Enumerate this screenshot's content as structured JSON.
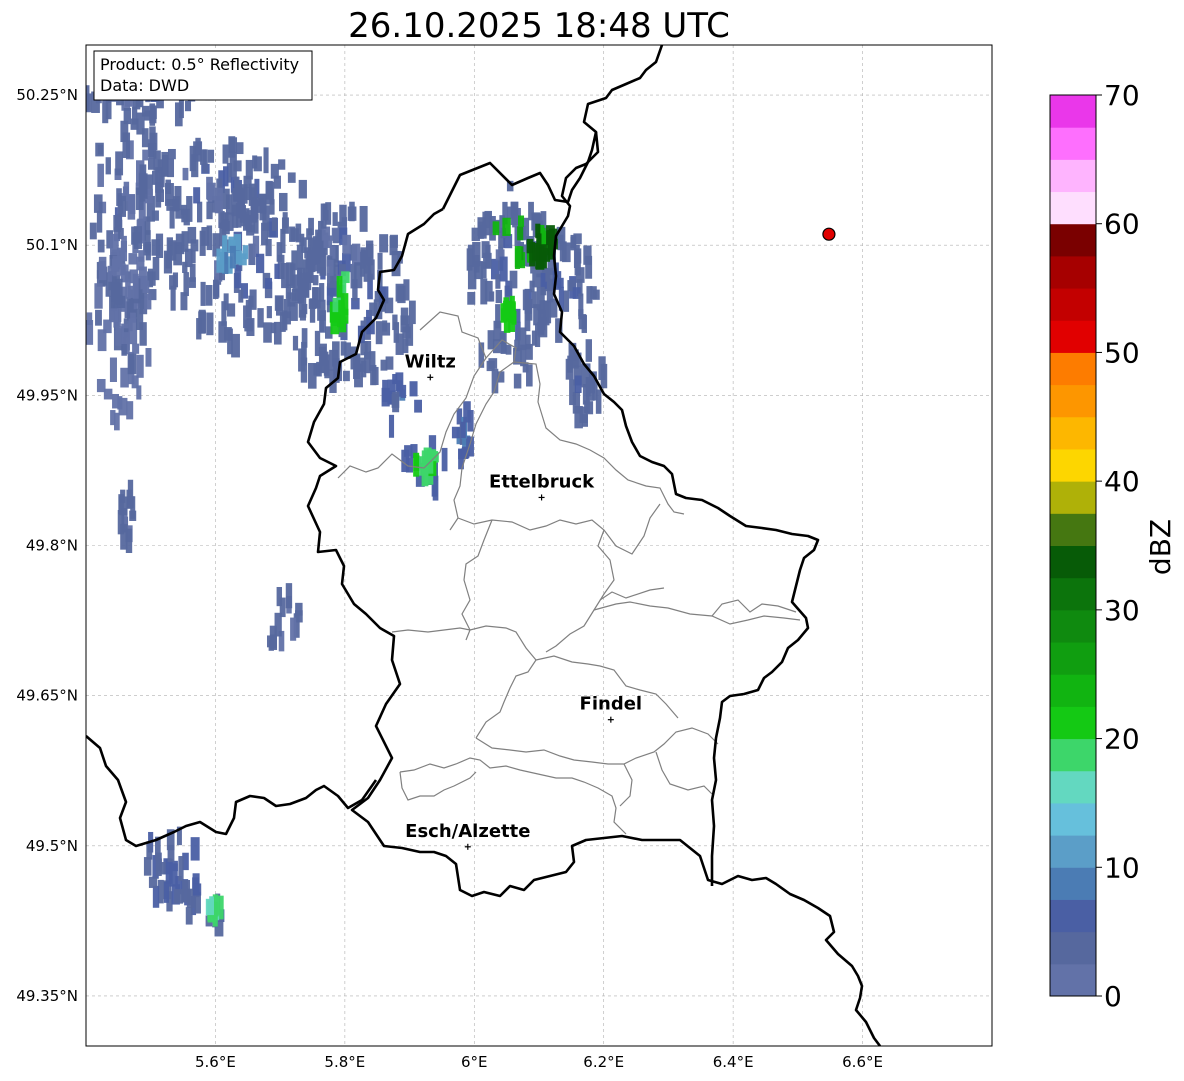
{
  "title": "26.10.2025 18:48 UTC",
  "info_box": {
    "product": "Product: 0.5° Reflectivity",
    "data": "Data: DWD"
  },
  "lon_ticks": [
    {
      "value": 5.6,
      "label": "5.6°E"
    },
    {
      "value": 5.8,
      "label": "5.8°E"
    },
    {
      "value": 6.0,
      "label": "6°E"
    },
    {
      "value": 6.2,
      "label": "6.2°E"
    },
    {
      "value": 6.4,
      "label": "6.4°E"
    },
    {
      "value": 6.6,
      "label": "6.6°E"
    }
  ],
  "lat_ticks": [
    {
      "value": 50.25,
      "label": "50.25°N"
    },
    {
      "value": 50.1,
      "label": "50.1°N"
    },
    {
      "value": 49.95,
      "label": "49.95°N"
    },
    {
      "value": 49.8,
      "label": "49.8°N"
    },
    {
      "value": 49.65,
      "label": "49.65°N"
    },
    {
      "value": 49.5,
      "label": "49.5°N"
    },
    {
      "value": 49.35,
      "label": "49.35°N"
    }
  ],
  "extent": {
    "lon_min": 5.4,
    "lon_max": 6.8,
    "lat_min": 49.3,
    "lat_max": 50.3
  },
  "cities": [
    {
      "name": "Wiltz",
      "lon": 5.932,
      "lat": 49.968
    },
    {
      "name": "Ettelbruck",
      "lon": 6.104,
      "lat": 49.848
    },
    {
      "name": "Findel",
      "lon": 6.211,
      "lat": 49.626
    },
    {
      "name": "Esch/Alzette",
      "lon": 5.99,
      "lat": 49.499
    }
  ],
  "radar_site": {
    "lon": 6.548,
    "lat": 50.111,
    "color": "#e00000"
  },
  "colorbar": {
    "label": "dBZ",
    "min": 0,
    "max": 70,
    "ticks": [
      0,
      10,
      20,
      30,
      40,
      50,
      60,
      70
    ],
    "colors": [
      "#6272a8",
      "#56689e",
      "#4a5fa4",
      "#4b7cb4",
      "#5b9ec8",
      "#66c0dc",
      "#63d8c0",
      "#3dd66a",
      "#14c914",
      "#11b411",
      "#109e10",
      "#0f8a0f",
      "#0c740c",
      "#075b07",
      "#457711",
      "#afb108",
      "#fdd600",
      "#fdb700",
      "#fd9600",
      "#fd7c00",
      "#e10000",
      "#c30000",
      "#a60000",
      "#7a0000",
      "#fedefe",
      "#feb4fe",
      "#fe6ffe",
      "#ea37ea"
    ]
  },
  "echoes": [
    {
      "lon": 5.49,
      "lat": 50.26,
      "rlon": 0.1,
      "rlat": 0.025,
      "dbz": 3
    },
    {
      "lon": 5.46,
      "lat": 50.15,
      "rlon": 0.06,
      "rlat": 0.12,
      "dbz": 3
    },
    {
      "lon": 5.45,
      "lat": 50.02,
      "rlon": 0.05,
      "rlat": 0.09,
      "dbz": 2
    },
    {
      "lon": 5.6,
      "lat": 50.17,
      "rlon": 0.13,
      "rlat": 0.04,
      "dbz": 4
    },
    {
      "lon": 5.64,
      "lat": 50.09,
      "rlon": 0.12,
      "rlat": 0.08,
      "dbz": 4
    },
    {
      "lon": 5.8,
      "lat": 50.05,
      "rlon": 0.11,
      "rlat": 0.08,
      "dbz": 4
    },
    {
      "lon": 5.79,
      "lat": 50.11,
      "rlon": 0.06,
      "rlat": 0.04,
      "dbz": 3
    },
    {
      "lon": 5.88,
      "lat": 49.95,
      "rlon": 0.03,
      "rlat": 0.025,
      "dbz": 6
    },
    {
      "lon": 5.92,
      "lat": 49.89,
      "rlon": 0.035,
      "rlat": 0.025,
      "dbz": 6
    },
    {
      "lon": 5.98,
      "lat": 49.92,
      "rlon": 0.015,
      "rlat": 0.025,
      "dbz": 7
    },
    {
      "lon": 6.05,
      "lat": 50.07,
      "rlon": 0.07,
      "rlat": 0.1,
      "dbz": 4
    },
    {
      "lon": 6.13,
      "lat": 50.07,
      "rlon": 0.06,
      "rlat": 0.05,
      "dbz": 4
    },
    {
      "lon": 6.17,
      "lat": 49.98,
      "rlon": 0.03,
      "rlat": 0.06,
      "dbz": 4
    },
    {
      "lon": 5.7,
      "lat": 49.73,
      "rlon": 0.025,
      "rlat": 0.04,
      "dbz": 3
    },
    {
      "lon": 5.53,
      "lat": 49.49,
      "rlon": 0.05,
      "rlat": 0.04,
      "dbz": 5
    },
    {
      "lon": 5.57,
      "lat": 49.45,
      "rlon": 0.04,
      "rlat": 0.025,
      "dbz": 5
    },
    {
      "lon": 5.46,
      "lat": 49.84,
      "rlon": 0.012,
      "rlat": 0.03,
      "dbz": 3
    },
    {
      "lon": 5.62,
      "lat": 50.1,
      "rlon": 0.025,
      "rlat": 0.012,
      "dbz": 10
    },
    {
      "lon": 5.79,
      "lat": 50.05,
      "rlon": 0.015,
      "rlat": 0.03,
      "dbz": 20
    },
    {
      "lon": 6.06,
      "lat": 50.11,
      "rlon": 0.05,
      "rlat": 0.02,
      "dbz": 24
    },
    {
      "lon": 6.1,
      "lat": 50.11,
      "rlon": 0.02,
      "rlat": 0.014,
      "dbz": 33
    },
    {
      "lon": 6.05,
      "lat": 50.04,
      "rlon": 0.012,
      "rlat": 0.012,
      "dbz": 21
    },
    {
      "lon": 5.92,
      "lat": 49.89,
      "rlon": 0.015,
      "rlat": 0.01,
      "dbz": 20
    },
    {
      "lon": 5.59,
      "lat": 49.45,
      "rlon": 0.01,
      "rlat": 0.01,
      "dbz": 18
    }
  ]
}
